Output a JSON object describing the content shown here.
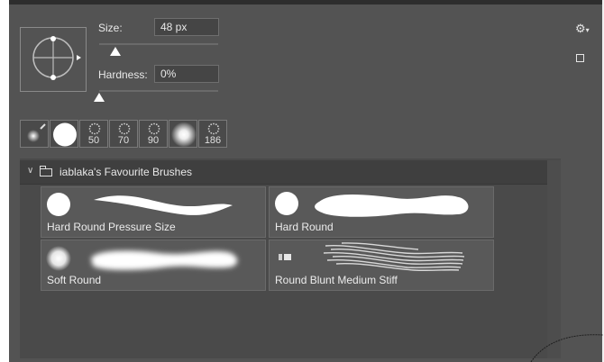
{
  "brush_settings": {
    "size_label": "Size:",
    "size_value": "48 px",
    "size_level": 0.14,
    "hardness_label": "Hardness:",
    "hardness_value": "0%",
    "hardness_level": 0.0
  },
  "recent_tips": [
    {
      "kind": "soft-small",
      "label": ""
    },
    {
      "kind": "hard-large",
      "label": ""
    },
    {
      "kind": "scatter",
      "label": "50"
    },
    {
      "kind": "scatter",
      "label": "70"
    },
    {
      "kind": "scatter",
      "label": "90"
    },
    {
      "kind": "soft-large",
      "label": ""
    },
    {
      "kind": "scatter",
      "label": "186"
    }
  ],
  "preset_group": {
    "title": "iablaka's Favourite Brushes",
    "brushes": [
      {
        "name": "Hard Round Pressure Size"
      },
      {
        "name": "Hard Round"
      },
      {
        "name": "Soft Round"
      },
      {
        "name": "Round Blunt Medium Stiff"
      }
    ]
  },
  "icons": {
    "gear": "gear-icon",
    "new_preset": "new-preset-icon",
    "folder": "folder-icon",
    "chevron": "chevron-down-icon"
  }
}
